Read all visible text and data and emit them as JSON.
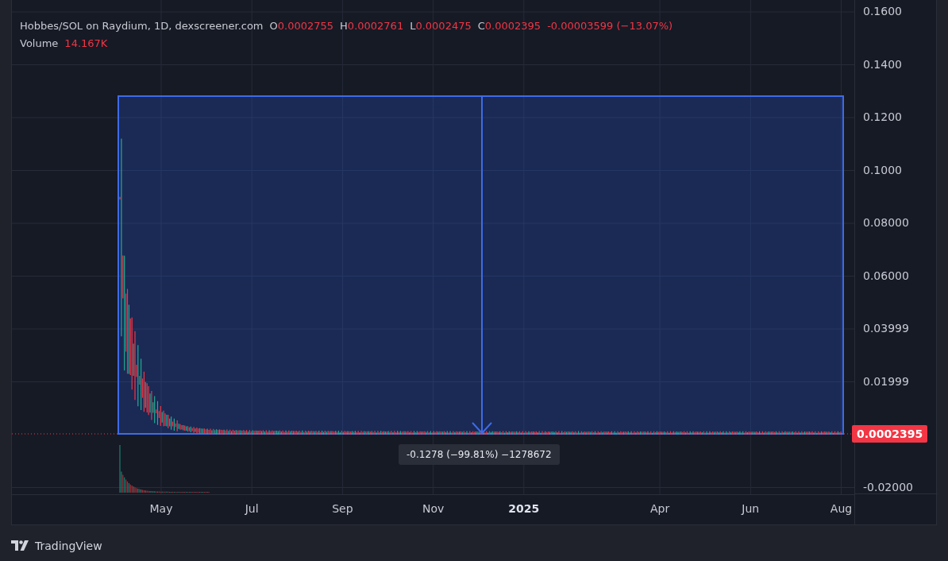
{
  "legend": {
    "symbol": "Hobbes/SOL on Raydium, 1D, dexscreener.com",
    "ohlc": [
      {
        "label": "O",
        "value": "0.0002755"
      },
      {
        "label": "H",
        "value": "0.0002761"
      },
      {
        "label": "L",
        "value": "0.0002475"
      },
      {
        "label": "C",
        "value": "0.0002395"
      }
    ],
    "change": "-0.00003599 (−13.07%)",
    "volume_label": "Volume",
    "volume": "14.167K"
  },
  "price_axis": {
    "ticks": [
      "0.1600",
      "0.1400",
      "0.1200",
      "0.1000",
      "0.08000",
      "0.06000",
      "0.03999",
      "0.01999",
      "-0.02000"
    ],
    "last_price": "0.0002395"
  },
  "time_axis": {
    "labels": [
      {
        "label": "May",
        "kind": "month"
      },
      {
        "label": "Jul",
        "kind": "month"
      },
      {
        "label": "Sep",
        "kind": "month"
      },
      {
        "label": "Nov",
        "kind": "month"
      },
      {
        "label": "2025",
        "kind": "year"
      },
      {
        "label": "Apr",
        "kind": "month"
      },
      {
        "label": "Jun",
        "kind": "month"
      },
      {
        "label": "Aug",
        "kind": "month"
      }
    ]
  },
  "measure": {
    "label": "-0.1278 (−99.81%) −1278672"
  },
  "brand": {
    "name": "TradingView"
  }
}
